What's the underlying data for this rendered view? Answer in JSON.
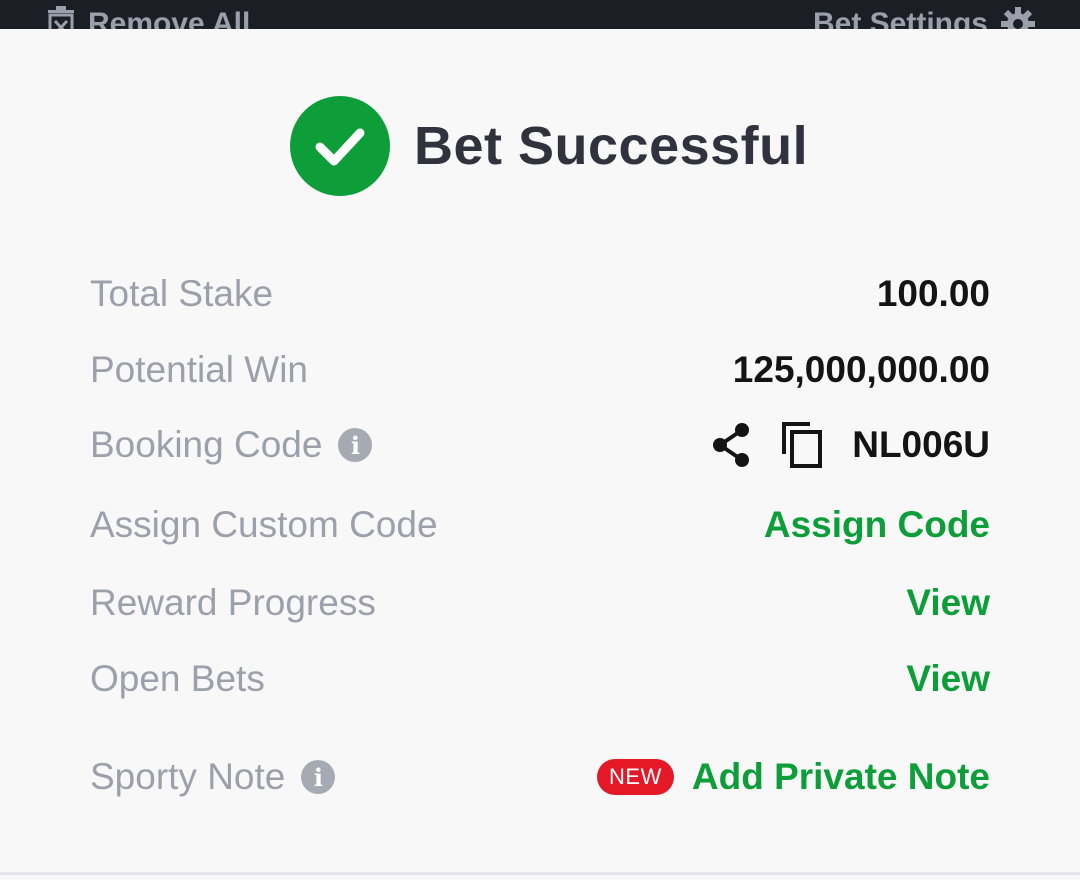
{
  "topbar": {
    "remove_all_label": "Remove All",
    "bet_settings_label": "Bet Settings"
  },
  "header": {
    "title": "Bet Successful",
    "icon": "check-circle-icon",
    "accent_color": "#0d9e3a"
  },
  "rows": {
    "total_stake": {
      "label": "Total Stake",
      "value": "100.00"
    },
    "potential_win": {
      "label": "Potential Win",
      "value": "125,000,000.00"
    },
    "booking_code": {
      "label": "Booking Code",
      "value": "NL006U",
      "icons": [
        "share-icon",
        "copy-icon"
      ]
    },
    "assign_custom_code": {
      "label": "Assign Custom Code",
      "action": "Assign Code"
    },
    "reward_progress": {
      "label": "Reward Progress",
      "action": "View"
    },
    "open_bets": {
      "label": "Open Bets",
      "action": "View"
    },
    "sporty_note": {
      "label": "Sporty Note",
      "badge": "NEW",
      "action": "Add Private Note",
      "badge_color": "#e41827"
    }
  },
  "info_icon_glyph": "i"
}
